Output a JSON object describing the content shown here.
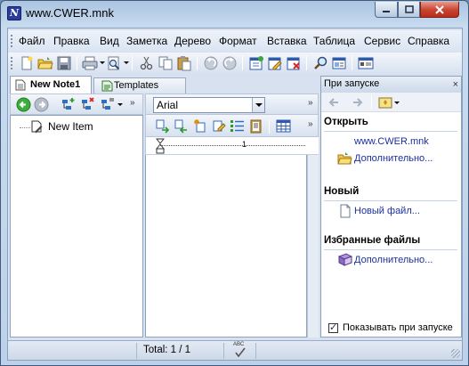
{
  "window": {
    "title": "www.CWER.mnk"
  },
  "menu": {
    "items": [
      "Файл",
      "Правка",
      "Вид",
      "Заметка",
      "Дерево",
      "Формат",
      "Вставка",
      "Таблица",
      "Сервис",
      "Справка"
    ]
  },
  "tabs": [
    {
      "label": "New Note1",
      "active": true
    },
    {
      "label": "Templates",
      "active": false
    }
  ],
  "tree": {
    "items": [
      {
        "label": "New Item"
      }
    ]
  },
  "editor": {
    "font_name": "Arial",
    "ruler_mark": "1"
  },
  "task_panel": {
    "header": "При запуске",
    "close_glyph": "×",
    "sections": {
      "open": {
        "title": "Открыть",
        "recent_file": "www.CWER.mnk",
        "more_link": "Дополнительно..."
      },
      "new": {
        "title": "Новый",
        "new_file_link": "Новый файл..."
      },
      "favorites": {
        "title": "Избранные файлы",
        "more_link": "Дополнительно..."
      }
    },
    "show_on_startup": {
      "label": "Показывать при запуске",
      "checked": true
    }
  },
  "statusbar": {
    "total": "Total: 1 / 1",
    "spell_label": "ABC"
  },
  "colors": {
    "link": "#1a2fa0",
    "close_button": "#c94230",
    "frame": "#aac4e0"
  }
}
